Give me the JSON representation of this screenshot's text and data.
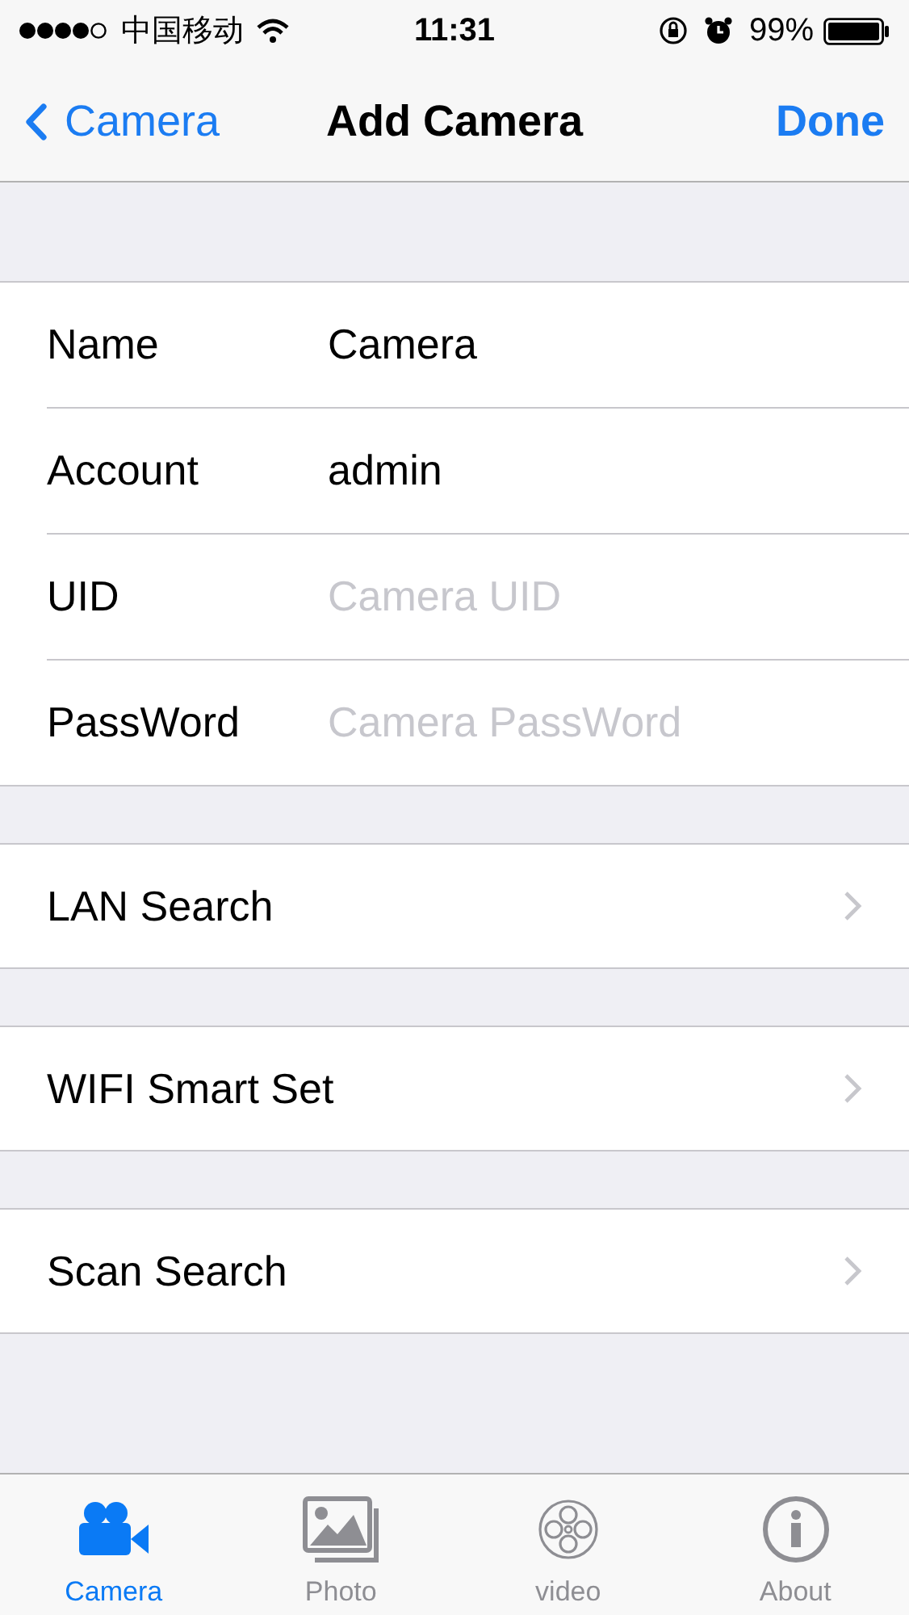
{
  "status_bar": {
    "carrier": "中国移动",
    "time": "11:31",
    "battery": "99%"
  },
  "nav": {
    "back": "Camera",
    "title": "Add Camera",
    "action": "Done"
  },
  "form": [
    {
      "label": "Name",
      "value": "Camera"
    },
    {
      "label": "Account",
      "value": "admin"
    },
    {
      "label": "UID",
      "placeholder": "Camera UID"
    },
    {
      "label": "PassWord",
      "placeholder": "Camera PassWord"
    }
  ],
  "actions": [
    {
      "label": "LAN Search"
    },
    {
      "label": "WIFI Smart Set"
    },
    {
      "label": "Scan Search"
    }
  ],
  "tabs": [
    {
      "label": "Camera",
      "selected": true
    },
    {
      "label": "Photo",
      "selected": false
    },
    {
      "label": "video",
      "selected": false
    },
    {
      "label": "About",
      "selected": false
    }
  ]
}
